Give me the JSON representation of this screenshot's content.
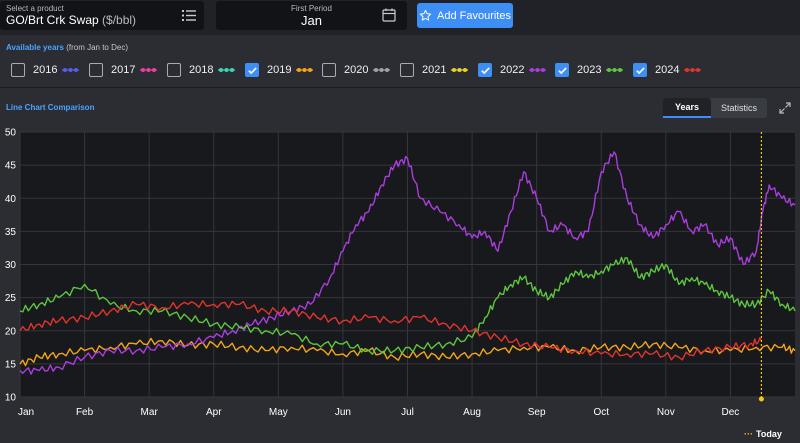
{
  "product": {
    "label": "Select a product",
    "name": "GO/Brt Crk Swap",
    "unit": "($/bbl)"
  },
  "period": {
    "label": "First Period",
    "value": "Jan"
  },
  "favourites_label": "Add Favourites",
  "years_selector": {
    "title": "Available years",
    "subtitle": "(from Jan to Dec)",
    "items": [
      {
        "year": "2016",
        "checked": false,
        "color": "#5b5bf0"
      },
      {
        "year": "2017",
        "checked": false,
        "color": "#ee3fa3"
      },
      {
        "year": "2018",
        "checked": false,
        "color": "#3ad6b8"
      },
      {
        "year": "2019",
        "checked": true,
        "color": "#f2a51a"
      },
      {
        "year": "2020",
        "checked": false,
        "color": "#9ea2aa"
      },
      {
        "year": "2021",
        "checked": false,
        "color": "#e8d41c"
      },
      {
        "year": "2022",
        "checked": true,
        "color": "#a93ddd"
      },
      {
        "year": "2023",
        "checked": true,
        "color": "#5dc63f"
      },
      {
        "year": "2024",
        "checked": true,
        "color": "#e0342e"
      }
    ]
  },
  "chart_section": {
    "title": "Line Chart Comparison",
    "tabs": [
      {
        "label": "Years",
        "active": true
      },
      {
        "label": "Statistics",
        "active": false
      }
    ],
    "today_label": "Today",
    "today_color": "#f5c518"
  },
  "chart_data": {
    "type": "line",
    "x_tick_labels": [
      "Jan",
      "Feb",
      "Mar",
      "Apr",
      "May",
      "Jun",
      "Jul",
      "Aug",
      "Sep",
      "Oct",
      "Nov",
      "Dec"
    ],
    "y_ticks": [
      10,
      15,
      20,
      25,
      30,
      35,
      40,
      45,
      50
    ],
    "ylim": [
      10,
      50
    ],
    "xlim": [
      0,
      12
    ],
    "grid": true,
    "today_x": 11.48,
    "series": [
      {
        "name": "2019",
        "color": "#f2a51a",
        "x": [
          0,
          0.3,
          0.6,
          1.0,
          1.4,
          1.8,
          2.2,
          2.6,
          3.0,
          3.4,
          3.8,
          4.2,
          4.6,
          5.0,
          5.4,
          5.8,
          6.2,
          6.6,
          7.0,
          7.4,
          7.8,
          8.2,
          8.6,
          9.0,
          9.4,
          9.8,
          10.2,
          10.6,
          11.0,
          11.4,
          11.8,
          12.0
        ],
        "y": [
          15,
          16,
          16.5,
          17,
          17.5,
          18,
          18.5,
          17.8,
          18,
          17.5,
          17,
          17.5,
          17,
          16.5,
          17,
          16,
          16.5,
          16,
          16.5,
          17,
          17.5,
          17.5,
          17,
          17.5,
          17.5,
          18,
          17.5,
          17,
          17,
          17.5,
          17.5,
          17
        ]
      },
      {
        "name": "2022",
        "color": "#a93ddd",
        "x": [
          0,
          0.3,
          0.6,
          1.0,
          1.4,
          1.8,
          2.2,
          2.6,
          3.0,
          3.3,
          3.6,
          3.9,
          4.2,
          4.5,
          4.8,
          5.0,
          5.2,
          5.4,
          5.6,
          5.8,
          6.0,
          6.2,
          6.5,
          6.8,
          7.0,
          7.2,
          7.4,
          7.6,
          7.8,
          8.0,
          8.2,
          8.4,
          8.6,
          8.8,
          9.0,
          9.2,
          9.4,
          9.6,
          9.8,
          10.0,
          10.2,
          10.4,
          10.6,
          10.8,
          11.0,
          11.2,
          11.4,
          11.5,
          11.6,
          11.8,
          12.0
        ],
        "y": [
          14,
          14,
          14.5,
          16,
          17,
          17,
          17.5,
          18,
          19,
          20,
          21,
          22,
          23,
          24,
          28,
          32,
          36,
          38,
          42,
          45,
          46,
          40,
          38,
          36,
          34,
          35,
          32,
          38,
          44,
          40,
          35,
          36,
          34,
          35,
          44,
          47,
          40,
          36,
          34,
          36,
          38,
          35,
          36,
          33,
          34,
          30,
          32,
          38,
          42,
          40,
          39
        ]
      },
      {
        "name": "2023",
        "color": "#5dc63f",
        "x": [
          0,
          0.3,
          0.6,
          1.0,
          1.4,
          1.8,
          2.2,
          2.6,
          3.0,
          3.4,
          3.8,
          4.2,
          4.6,
          5.0,
          5.4,
          5.8,
          6.2,
          6.6,
          7.0,
          7.2,
          7.4,
          7.6,
          7.8,
          8.0,
          8.2,
          8.4,
          8.6,
          8.8,
          9.0,
          9.2,
          9.4,
          9.6,
          9.8,
          10.0,
          10.2,
          10.4,
          10.6,
          10.8,
          11.0,
          11.2,
          11.4,
          11.6,
          11.8,
          12.0
        ],
        "y": [
          23,
          24,
          25,
          27,
          24,
          23,
          23,
          22,
          21,
          20.5,
          20,
          19.5,
          18,
          18,
          17,
          17,
          17.5,
          18,
          19,
          22,
          25,
          27,
          28,
          26,
          25,
          27,
          29,
          28,
          29,
          30,
          31,
          28,
          29,
          30,
          27,
          28,
          27,
          26,
          25,
          24,
          24,
          26,
          24,
          23
        ]
      },
      {
        "name": "2024",
        "color": "#e0342e",
        "x": [
          0,
          0.3,
          0.6,
          1.0,
          1.4,
          1.8,
          2.2,
          2.6,
          3.0,
          3.4,
          3.8,
          4.2,
          4.6,
          5.0,
          5.4,
          5.8,
          6.2,
          6.6,
          7.0,
          7.4,
          7.8,
          8.2,
          8.6,
          9.0,
          9.4,
          9.8,
          10.2,
          10.6,
          11.0,
          11.3,
          11.48
        ],
        "y": [
          20,
          21,
          21.5,
          22,
          23,
          24,
          23.5,
          24,
          24,
          24,
          23,
          23,
          22,
          21.5,
          22,
          21.5,
          22,
          21,
          20,
          19,
          18,
          17.5,
          17,
          16.5,
          16.5,
          16.5,
          16,
          17,
          17.5,
          18,
          18.5
        ]
      }
    ]
  }
}
